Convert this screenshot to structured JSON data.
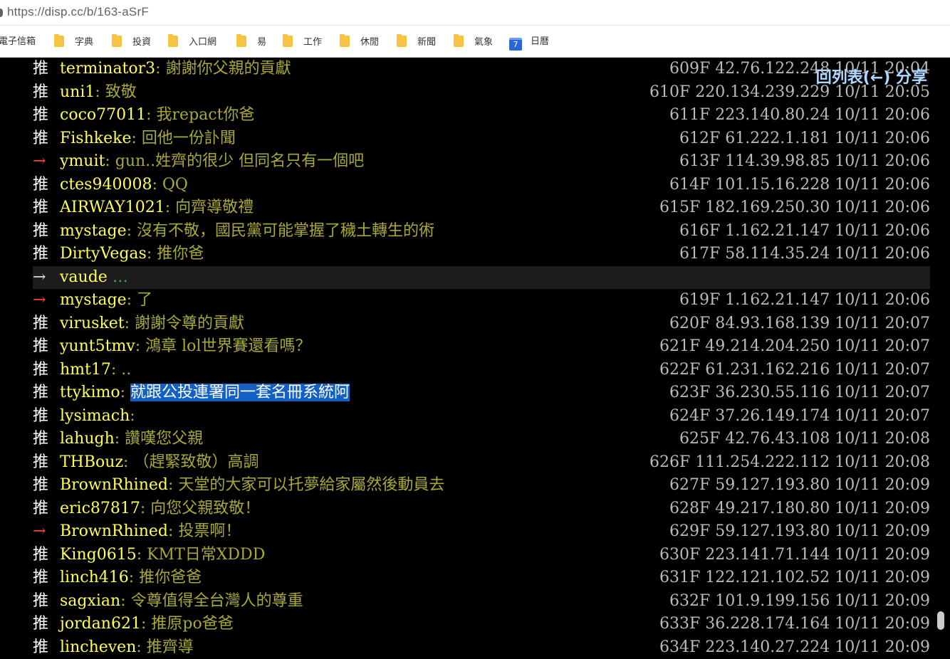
{
  "browser": {
    "url": "https://disp.cc/b/163-aSrF",
    "bookmarks": [
      {
        "label": "電子信箱",
        "icon": "none"
      },
      {
        "label": "字典",
        "icon": "folder-icon"
      },
      {
        "label": "投資",
        "icon": "folder-icon"
      },
      {
        "label": "入口網",
        "icon": "folder-icon"
      },
      {
        "label": "易",
        "icon": "folder-icon"
      },
      {
        "label": "工作",
        "icon": "folder-icon"
      },
      {
        "label": "休閒",
        "icon": "folder-icon"
      },
      {
        "label": "新聞",
        "icon": "folder-icon"
      },
      {
        "label": "氣象",
        "icon": "folder-icon"
      },
      {
        "label": "日曆",
        "icon": "calendar-icon",
        "icon_text": "7"
      }
    ]
  },
  "nav": {
    "back_label": "回列表(←) 分享"
  },
  "comments": [
    {
      "tag": "推",
      "user": "terminator3",
      "text": "謝謝你父親的貢獻",
      "meta": "609F 42.76.122.248 10/11 20:04"
    },
    {
      "tag": "推",
      "user": "uni1",
      "text": "致敬",
      "meta": "610F 220.134.239.229 10/11 20:05"
    },
    {
      "tag": "推",
      "user": "coco77011",
      "text": "我repact你爸",
      "meta": "611F 223.140.80.24 10/11 20:06"
    },
    {
      "tag": "推",
      "user": "Fishkeke",
      "text": "回他一份訃聞",
      "meta": "612F 61.222.1.181 10/11 20:06"
    },
    {
      "tag": "→",
      "user": "ymuit",
      "text": "gun..姓齊的很少 但同名只有一個吧",
      "meta": "613F 114.39.98.85 10/11 20:06"
    },
    {
      "tag": "推",
      "user": "ctes940008",
      "text": "QQ",
      "meta": "614F 101.15.16.228 10/11 20:06"
    },
    {
      "tag": "推",
      "user": "AIRWAY1021",
      "text": "向齊導敬禮",
      "meta": "615F 182.169.250.30 10/11 20:06"
    },
    {
      "tag": "推",
      "user": "mystage",
      "text": "沒有不敬，國民黨可能掌握了穢土轉生的術",
      "meta": "616F 1.162.21.147 10/11 20:06"
    },
    {
      "tag": "推",
      "user": "DirtyVegas",
      "text": "推你爸",
      "meta": "617F 58.114.35.24 10/11 20:06"
    },
    {
      "tag": "→",
      "user": "vaude",
      "text": "",
      "ellipsis": "…",
      "meta": "",
      "highlight": true
    },
    {
      "tag": "→",
      "user": "mystage",
      "text": "了",
      "meta": "619F 1.162.21.147 10/11 20:06"
    },
    {
      "tag": "推",
      "user": "virusket",
      "text": "謝謝令尊的貢獻",
      "meta": "620F 84.93.168.139 10/11 20:07"
    },
    {
      "tag": "推",
      "user": "yunt5tmv",
      "text": "鴻章 lol世界賽還看嗎？",
      "meta": "621F 49.214.204.250 10/11 20:07"
    },
    {
      "tag": "推",
      "user": "hmt17",
      "text": "..",
      "meta": "622F 61.231.162.216 10/11 20:07"
    },
    {
      "tag": "推",
      "user": "ttykimo",
      "text": "就跟公投連署同一套名冊系統阿",
      "meta": "623F 36.230.55.116 10/11 20:07",
      "selected": true
    },
    {
      "tag": "推",
      "user": "lysimach",
      "text": "",
      "meta": "624F 37.26.149.174 10/11 20:07"
    },
    {
      "tag": "推",
      "user": "lahugh",
      "text": "讚嘆您父親",
      "meta": "625F 42.76.43.108 10/11 20:08"
    },
    {
      "tag": "推",
      "user": "THBouz",
      "text": "（趕緊致敬）高調",
      "meta": "626F 111.254.222.112 10/11 20:08"
    },
    {
      "tag": "推",
      "user": "BrownRhined",
      "text": "天堂的大家可以托夢給家屬然後動員去",
      "meta": "627F 59.127.193.80 10/11 20:09"
    },
    {
      "tag": "推",
      "user": "eric87817",
      "text": "向您父親致敬！",
      "meta": "628F 49.217.180.80 10/11 20:09"
    },
    {
      "tag": "→",
      "user": "BrownRhined",
      "text": "投票啊！",
      "meta": "629F 59.127.193.80 10/11 20:09"
    },
    {
      "tag": "推",
      "user": "King0615",
      "text": "KMT日常XDDD",
      "meta": "630F 223.141.71.144 10/11 20:09"
    },
    {
      "tag": "推",
      "user": "linch416",
      "text": "推你爸爸",
      "meta": "631F 122.121.102.52 10/11 20:09"
    },
    {
      "tag": "推",
      "user": "sagxian",
      "text": "令尊值得全台灣人的尊重",
      "meta": "632F 101.9.199.156 10/11 20:09"
    },
    {
      "tag": "推",
      "user": "jordan621",
      "text": "推原po爸爸",
      "meta": "633F 36.228.174.164 10/11 20:09"
    },
    {
      "tag": "推",
      "user": "lincheven",
      "text": "推齊導",
      "meta": "634F 223.140.27.224 10/11 20:09"
    }
  ]
}
